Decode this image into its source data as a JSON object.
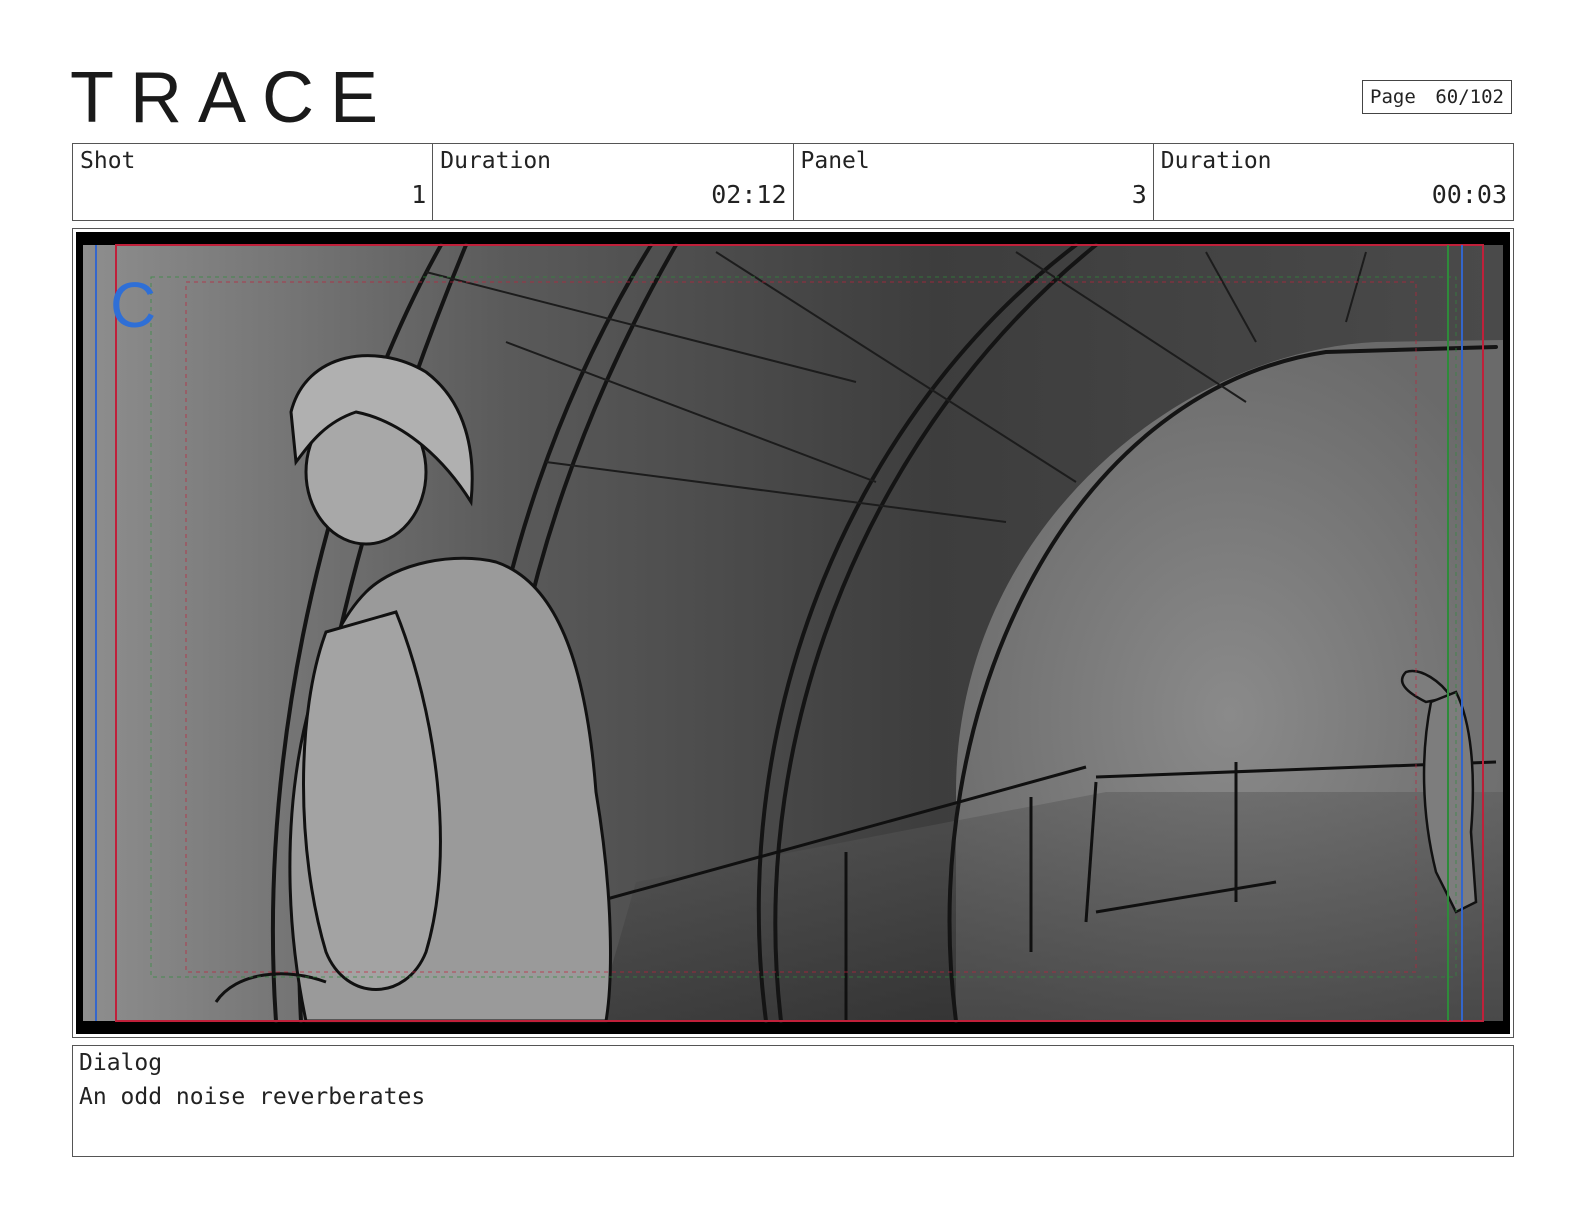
{
  "header": {
    "title": "TRACE",
    "page_label": "Page",
    "page_value": "60/102"
  },
  "info": {
    "shot_label": "Shot",
    "shot_value": "1",
    "shot_duration_label": "Duration",
    "shot_duration_value": "02:12",
    "panel_label": "Panel",
    "panel_value": "3",
    "panel_duration_label": "Duration",
    "panel_duration_value": "00:03"
  },
  "frame": {
    "camera_letter": "C",
    "colors": {
      "safe_red": "#c0203a",
      "guide_blue": "#3366cc",
      "guide_green": "#2e8b3a",
      "letter_blue": "#2f6fd6"
    }
  },
  "dialog": {
    "label": "Dialog",
    "text": "An odd noise reverberates"
  }
}
